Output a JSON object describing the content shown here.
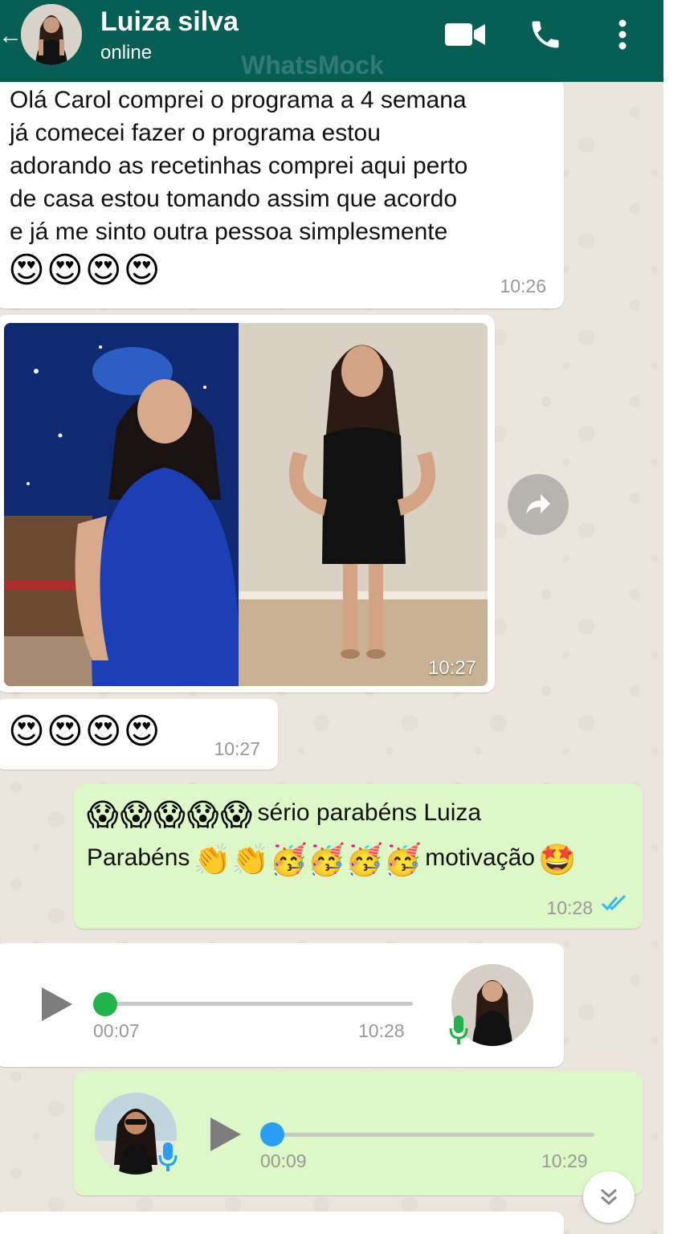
{
  "header": {
    "contact_name": "Luiza silva",
    "status": "online",
    "watermark": "WhatsMock",
    "icons": [
      "back-arrow-icon",
      "video-call-icon",
      "phone-icon",
      "more-options-icon"
    ]
  },
  "messages": [
    {
      "direction": "incoming",
      "type": "text",
      "lines": [
        "Olá Carol comprei o programa a 4 semana",
        "já comecei fazer o programa estou",
        "adorando as recetinhas comprei aqui perto",
        "de casa estou tomando assim que acordo",
        "e já me sinto outra pessoa simplesmente"
      ],
      "emoji": "😍😍😍😍",
      "time": "10:26"
    },
    {
      "direction": "incoming",
      "type": "image",
      "time": "10:27"
    },
    {
      "direction": "incoming",
      "type": "text",
      "emoji": "😍😍😍😍",
      "time": "10:27"
    },
    {
      "direction": "outgoing",
      "type": "text",
      "line1_emoji": "😱😱😱😱😱",
      "line1_text": "sério parabéns Luiza",
      "line2_text_a": "Parabéns",
      "line2_emoji": "👏👏🥳🥳🥳🥳",
      "line2_text_b": "motivação",
      "line2_emoji_end": "🤩",
      "time": "10:28",
      "read_receipt": "double-check-blue"
    },
    {
      "direction": "incoming",
      "type": "audio",
      "duration": "00:07",
      "time": "10:28",
      "progress": 0
    },
    {
      "direction": "outgoing",
      "type": "audio",
      "duration": "00:09",
      "time": "10:29",
      "progress": 0
    }
  ],
  "colors": {
    "header": "#075e54",
    "chat_bg": "#ece5dd",
    "incoming": "#ffffff",
    "outgoing": "#dcf8c6",
    "read_tick": "#34b7f1",
    "audio_knob_incoming": "#1fb34a",
    "audio_knob_outgoing": "#2a9df4"
  }
}
